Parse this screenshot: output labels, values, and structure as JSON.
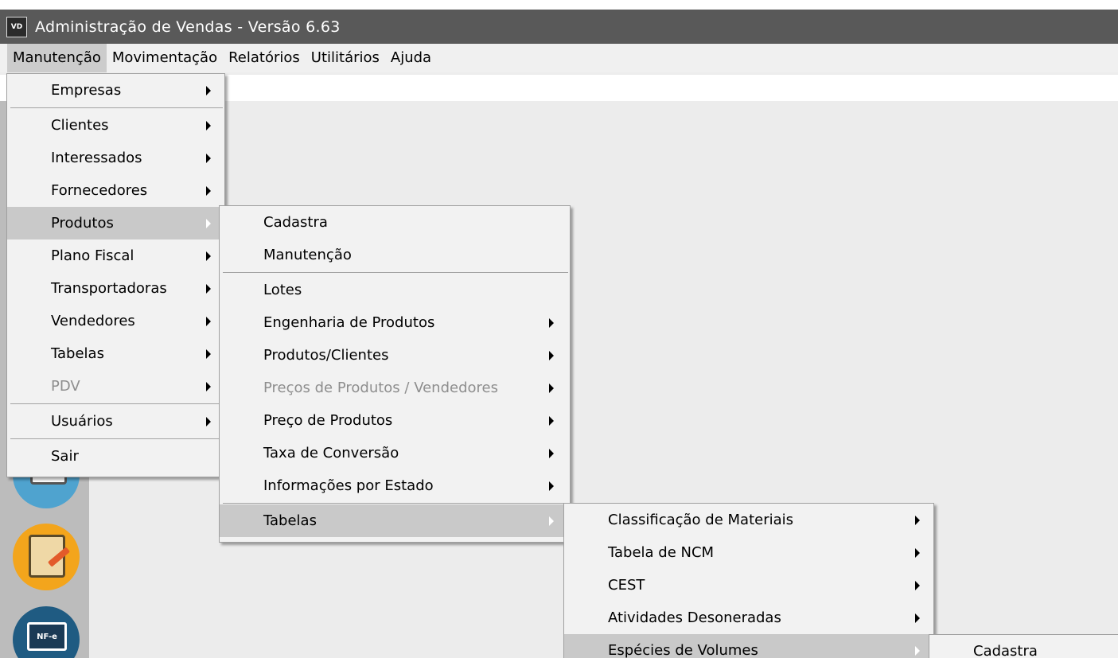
{
  "window": {
    "app_icon_text": "VD",
    "title": "Administração de Vendas - Versão 6.63"
  },
  "menubar": {
    "items": [
      {
        "label": "Manutenção"
      },
      {
        "label": "Movimentação"
      },
      {
        "label": "Relatórios"
      },
      {
        "label": "Utilitários"
      },
      {
        "label": "Ajuda"
      }
    ]
  },
  "manutencao_menu": {
    "items": [
      {
        "label": "Empresas",
        "submenu": true
      },
      {
        "label": "Clientes",
        "submenu": true
      },
      {
        "label": "Interessados",
        "submenu": true
      },
      {
        "label": "Fornecedores",
        "submenu": true
      },
      {
        "label": "Produtos",
        "submenu": true,
        "highlighted": true
      },
      {
        "label": "Plano Fiscal",
        "submenu": true
      },
      {
        "label": "Transportadoras",
        "submenu": true
      },
      {
        "label": "Vendedores",
        "submenu": true
      },
      {
        "label": "Tabelas",
        "submenu": true
      },
      {
        "label": "PDV",
        "submenu": true,
        "disabled": true
      },
      {
        "label": "Usuários",
        "submenu": true
      },
      {
        "label": "Sair"
      }
    ]
  },
  "produtos_menu": {
    "items": [
      {
        "label": "Cadastra"
      },
      {
        "label": "Manutenção"
      },
      {
        "label": "Lotes"
      },
      {
        "label": "Engenharia de Produtos",
        "submenu": true
      },
      {
        "label": "Produtos/Clientes",
        "submenu": true
      },
      {
        "label": "Preços de Produtos / Vendedores",
        "submenu": true,
        "disabled": true
      },
      {
        "label": "Preço de Produtos",
        "submenu": true
      },
      {
        "label": "Taxa de Conversão",
        "submenu": true
      },
      {
        "label": "Informações por Estado",
        "submenu": true
      },
      {
        "label": "Tabelas",
        "submenu": true,
        "highlighted": true
      }
    ]
  },
  "tabelas_menu": {
    "items": [
      {
        "label": "Classificação de Materiais",
        "submenu": true
      },
      {
        "label": "Tabela de NCM",
        "submenu": true
      },
      {
        "label": "CEST",
        "submenu": true
      },
      {
        "label": "Atividades Desoneradas",
        "submenu": true
      },
      {
        "label": "Espécies de Volumes",
        "submenu": true,
        "highlighted": true
      }
    ]
  },
  "especies_menu": {
    "items": [
      {
        "label": "Cadastra"
      }
    ]
  },
  "launcher": {
    "icons": [
      "list-icon",
      "document-edit-icon",
      "nfe-laptop-icon"
    ],
    "nfe_label": "NF-e"
  }
}
